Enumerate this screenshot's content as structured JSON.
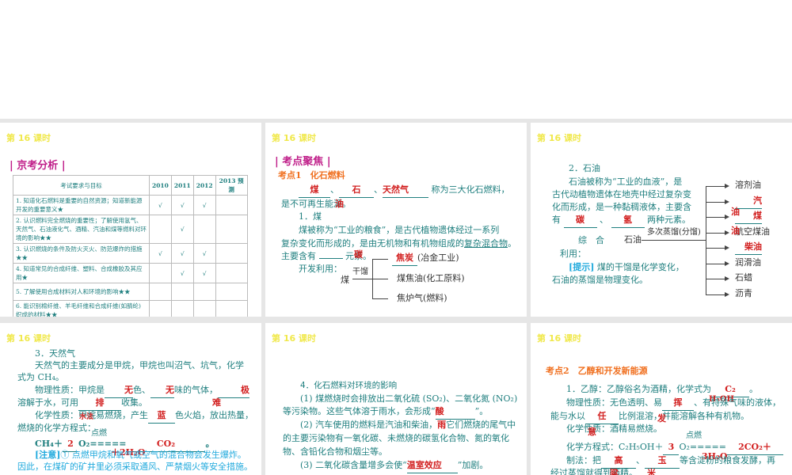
{
  "slide_header": "第 16 课时",
  "s1": {
    "section": "京考分析",
    "columns": [
      "考试要求与目标",
      "2010",
      "2011",
      "2012",
      "2013 预测"
    ],
    "rows": [
      {
        "text": "1. 知道化石燃料是重要的自然资源；知道新能源开发的重要意义★",
        "marks": [
          "√",
          "√",
          "√",
          ""
        ]
      },
      {
        "text": "2. 认识燃料完全燃烧的重要性；了解使用氢气、天然气、石油液化气、酒精、汽油和煤等燃料对环境的影响★★",
        "marks": [
          "",
          "√",
          "",
          ""
        ]
      },
      {
        "text": "3. 认识燃烧的条件及防火灭火、防范爆炸的措施★★",
        "marks": [
          "√",
          "√",
          "√",
          ""
        ]
      },
      {
        "text": "4. 知道常见的合成纤维、塑料、合成橡胶及其应用★",
        "marks": [
          "",
          "√",
          "√",
          ""
        ]
      },
      {
        "text": "5. 了解使用合成材料对人和环境的影响★★",
        "marks": [
          "",
          "",
          "",
          ""
        ]
      },
      {
        "text": "6. 能识别棉纤维、羊毛纤维和合成纤维(如腈纶)织成的材料★★",
        "marks": [
          "",
          "",
          "",
          ""
        ]
      }
    ]
  },
  "s2": {
    "section": "考点聚焦",
    "topic": "考点1　化石燃料",
    "a1": "煤",
    "a2": "石",
    "a3": "天然气",
    "l1": "称为三大化石燃料，",
    "l2": "是不可再生能源。",
    "a2b": "油",
    "h": "1．煤",
    "p1": "煤被称为“工业的粮食”，是古代植物遗体经过一系列",
    "p2a": "复杂变化而形成的，是由无机物和有机物组成的",
    "p2b": "复杂混合物",
    "p3": "主要含有",
    "p3b": "元素。",
    "a4": "碳",
    "use": "开发利用：",
    "coal": "煤",
    "dry": "干馏",
    "o1": "焦炭",
    "o1b": "(冶金工业)",
    "o2": "煤焦油(化工原料)",
    "o3": "焦炉气(燃料)"
  },
  "s3": {
    "h": "2．石油",
    "p1": "石油被称为“工业的血液”，是",
    "p2": "古代动植物遗体在地壳中经过复杂变",
    "p3": "化而形成，是一种黏稠液体，主要含",
    "p4a": "有",
    "a1": "碳",
    "a2": "氢",
    "p4b": "两种元素。",
    "use1": "综　合",
    "use2": "利用：",
    "oil": "石油",
    "dist": "多次蒸馏(分馏)",
    "outs": [
      "溶剂油",
      "汽",
      "煤",
      "航空煤油",
      "柴油",
      "润滑油",
      "石蜡",
      "沥青"
    ],
    "extra1": "油",
    "extra2": "油",
    "tip": "[提示]",
    "tip1": "煤的干馏是化学变化，",
    "tip2": "石油的蒸馏是物理变化。"
  },
  "s4": {
    "h": "3．天然气",
    "p1": "天然气的主要成分是甲烷，甲烷也叫沼气、坑气，化学",
    "p2": "式为 CH₄。",
    "p3a": "物理性质：甲烷是",
    "b1": "无",
    "p3b": "色、",
    "b2": "无",
    "p3c": "味的气体，",
    "b3": "极",
    "p4a": "溶解于水，可用",
    "b4": "排",
    "p4b": "收集。",
    "b3b": "难",
    "p5a": "化学性质：甲烷易燃烧，产生",
    "b5": "蓝",
    "p5b": "色火焰，放出热量，",
    "b4b": "水法",
    "p6": "燃烧的化学方程式：",
    "eq1": "CH₄＋",
    "eq2": "O₂",
    "coef": "2",
    "cond": "点燃",
    "prod": "CO₂",
    "prod2": "＋2H₂O",
    "note": "[注意]",
    "note1": "① 点燃甲烷和氧气或空气的混合物会发生爆炸。",
    "note2": "因此，在煤矿的矿井里必须采取通风、严禁烟火等安全措施。"
  },
  "s5": {
    "h": "4．化石燃料对环境的影响",
    "p1": "(1) 煤燃烧时会排放出二氧化硫 (SO₂)、二氧化氮 (NO₂)",
    "p2a": "等污染物。这些气体溶于雨水，会形成“",
    "a1": "酸",
    "p2b": "”。",
    "p3a": "(2) 汽车使用的燃料是汽油和柴油，",
    "a1b": "雨",
    "p3b": "它们燃烧的尾气中",
    "p4": "的主要污染物有一氧化碳、未燃烧的碳氢化合物、氮的氧化",
    "p5": "物、含铅化合物和烟尘等。",
    "p6a": "(3) 二氧化碳含量增多会使“",
    "a2": "温室效应",
    "p6b": "”加剧。"
  },
  "s6": {
    "topic": "考点2　乙醇和开发新能源",
    "p1a": "1．乙醇：乙醇俗名为酒精，化学式为",
    "a1": "C₂",
    "a1b": "H₅OH",
    "p1b": "。",
    "p2a": "物理性质：无色透明、易",
    "a2": "挥",
    "p2b": "、有特殊气味的液体，",
    "p3a": "能与水以",
    "a3": "任",
    "p3b": "比例混溶，并能溶解各种有机物。",
    "a2b": "发",
    "a3b": "意",
    "p4": "化学性质：酒精易燃烧。",
    "p5": "化学方程式：C₂H₅OH＋",
    "coef": "3",
    "o2": "O₂",
    "cond": "点燃",
    "prod": "2CO₂＋",
    "prod2": "3H₂O",
    "p6a": "制法：把",
    "a4": "高",
    "a5": "玉",
    "p6b": "等含淀粉的粮食发酵，再",
    "p7": "经过蒸馏就得到酒精。",
    "a4b": "粱",
    "a5b": "米"
  }
}
